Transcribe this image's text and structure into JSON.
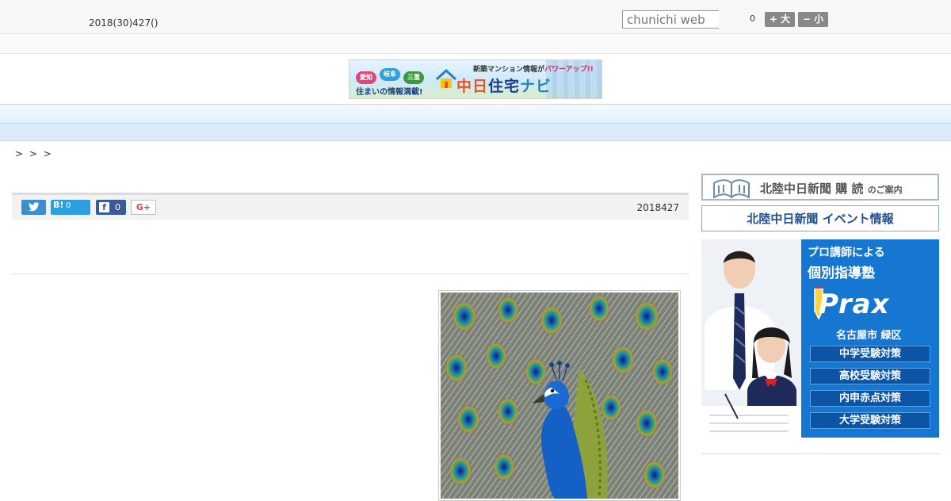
{
  "header": {
    "date": "2018(30)427()",
    "search_placeholder": "chunichi web",
    "count": "0",
    "font_increase": "+ 大",
    "font_decrease": "− 小"
  },
  "banner": {
    "pills": [
      "愛知",
      "岐阜",
      "三重"
    ],
    "tagline": "住まいの情報満載!",
    "kicker": "新築マンション情報が",
    "kicker_em": "パワーアップ!!",
    "brand_a": "中日",
    "brand_b": "住宅",
    "brand_c": "ナビ"
  },
  "nav": {
    "items": [
      "",
      "",
      "",
      "",
      "",
      "",
      "",
      "",
      ""
    ]
  },
  "breadcrumb": "> >  >",
  "article": {
    "hatena_label": "B!",
    "hatena_count": "0",
    "facebook_count": "0",
    "gplus_label": "G+",
    "date": "2018427"
  },
  "sidebar": {
    "subscribe_main": "北陸中日新聞 購 読",
    "subscribe_suffix": "のご案内",
    "event": "北陸中日新聞 イベント情報",
    "prax": {
      "line1": "プロ講師による",
      "line2": "個別指導塾",
      "logo": "Prax",
      "area": "名古屋市 緑区",
      "tags": [
        "中学受験対策",
        "高校受験対策",
        "内申赤点対策",
        "大学受験対策"
      ]
    }
  },
  "colors": {
    "nav_bg": "#e1effc",
    "twitter": "#3a8fd2",
    "hatena": "#2c9fe0",
    "facebook": "#3b5b98",
    "prax_blue": "#1677d2"
  }
}
